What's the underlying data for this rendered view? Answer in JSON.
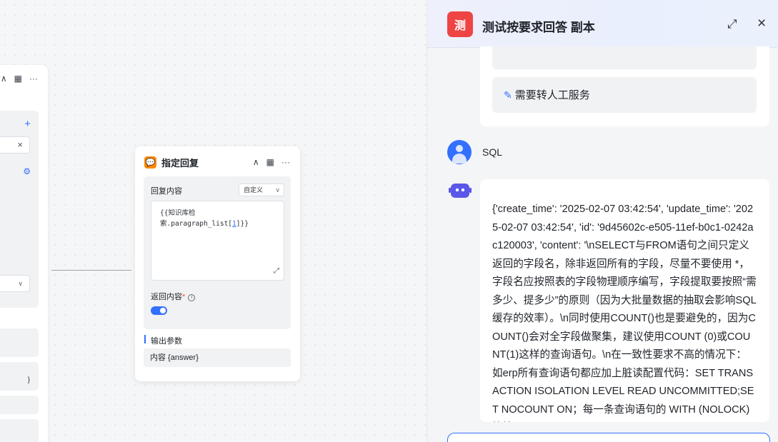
{
  "left_node": {
    "collapse_icon": "chevron-up-icon",
    "chip_close": "×",
    "row_text": "}"
  },
  "reply_node": {
    "title": "指定回复",
    "icon_text": "💬",
    "reply_content_label": "回复内容",
    "mode_select": "自定义",
    "template_line1": "{{知识库检",
    "template_line2_pre": "索.paragraph_list[",
    "template_index": "1",
    "template_line2_post": "]}}",
    "return_content_label": "返回内容",
    "required_mark": "*",
    "return_toggle_on": true,
    "output_section_label": "输出参数",
    "output_param": "内容 {answer}"
  },
  "chat": {
    "app_icon_text": "测",
    "title": "测试按要求回答 副本",
    "suggestion": "需要转人工服务",
    "user_message": "SQL",
    "bot_answer": "{'create_time': '2025-02-07 03:42:54', 'update_time': '2025-02-07 03:42:54', 'id': '9d45602c-e505-11ef-b0c1-0242ac120003', 'content': '\\nSELECT与FROM语句之间只定义返回的字段名，除非返回所有的字段，尽量不要使用 *， 字段名应按照表的字段物理顺序编写，字段提取要按照“需多少、提多少”的原则（因为大批量数据的抽取会影响SQL缓存的效率）。\\n同时使用COUNT()也是要避免的，因为COUNT()会对全字段做聚集，建议使用COUNT (0)或COUNT(1)这样的查询语句。\\n在一致性要求不高的情况下： 如erp所有查询语句都应加上脏读配置代码：SET TRANSACTION ISOLATION LEVEL READ UNCOMMITTED;SET NOCOUNT ON；每一条查询语句的 WITH (NOLOCK) 等等'"
  },
  "colors": {
    "primary": "#3370ff",
    "node_icon": "#ff8800",
    "app_icon": "#ef4444",
    "bot_avatar": "#5b57e8"
  }
}
